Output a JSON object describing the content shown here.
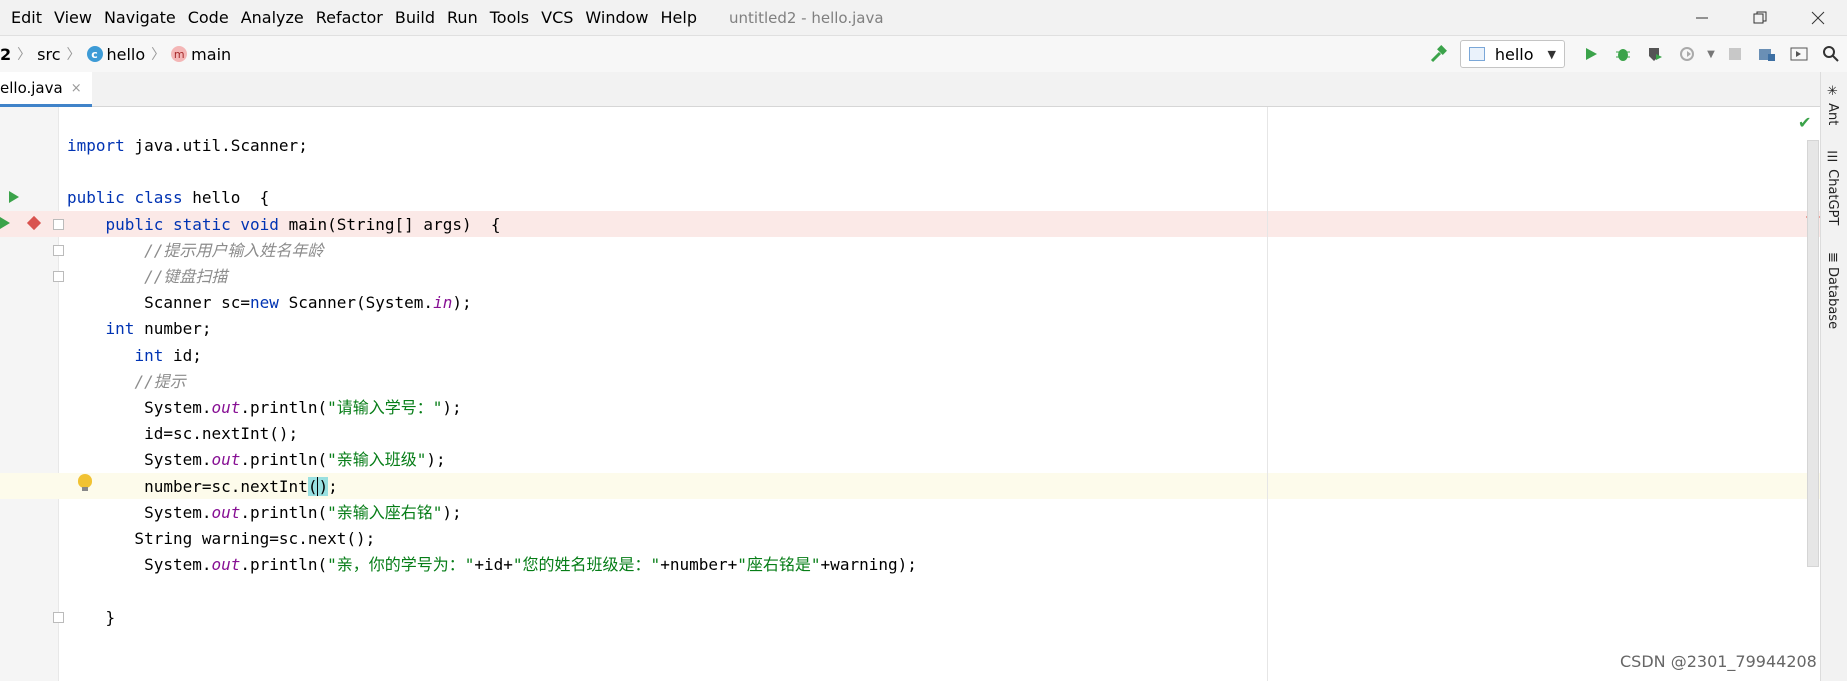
{
  "menubar": {
    "items": [
      "Edit",
      "View",
      "Navigate",
      "Code",
      "Analyze",
      "Refactor",
      "Build",
      "Run",
      "Tools",
      "VCS",
      "Window",
      "Help"
    ],
    "title": "untitled2 - hello.java"
  },
  "navbar": {
    "crumbs": [
      "2",
      "src",
      "hello",
      "main"
    ],
    "class_icon_letter": "c",
    "method_icon_letter": "m",
    "run_config": "hello"
  },
  "tabbar": {
    "active_tab": "hello.java",
    "active_tab_visible": "ello.java",
    "close_glyph": "×"
  },
  "editor": {
    "lines": [
      {
        "id": "l1",
        "text": "import java.util.Scanner;"
      },
      {
        "id": "l2",
        "text": ""
      },
      {
        "id": "l3",
        "text": "public class hello  {"
      },
      {
        "id": "l4",
        "text": "    public static void main(String[] args)  {"
      },
      {
        "id": "l5",
        "text": "        //提示用户输入姓名年龄"
      },
      {
        "id": "l6",
        "text": "        //键盘扫描"
      },
      {
        "id": "l7",
        "text": "        Scanner sc=new Scanner(System.in);"
      },
      {
        "id": "l8",
        "text": "    int number;"
      },
      {
        "id": "l9",
        "text": "       int id;"
      },
      {
        "id": "l10",
        "text": "       //提示"
      },
      {
        "id": "l11",
        "text": "        System.out.println(\"请输入学号：\");"
      },
      {
        "id": "l12",
        "text": "        id=sc.nextInt();"
      },
      {
        "id": "l13",
        "text": "        System.out.println(\"亲输入班级\");"
      },
      {
        "id": "l14",
        "text": "        number=sc.nextInt();"
      },
      {
        "id": "l15",
        "text": "        System.out.println(\"亲输入座右铭\");"
      },
      {
        "id": "l16",
        "text": "       String warning=sc.next();"
      },
      {
        "id": "l17",
        "text": "        System.out.println(\"亲，你的学号为：\"+id+\"您的姓名班级是：\"+number+\"座右铭是\"+warning);"
      },
      {
        "id": "l18",
        "text": ""
      },
      {
        "id": "l19",
        "text": "    }"
      }
    ]
  },
  "tool_strip": [
    "Ant",
    "ChatGPT",
    "Database"
  ],
  "watermark": "CSDN @2301_79944208",
  "colors": {
    "keyword": "#0033b3",
    "comment": "#8c8c8c",
    "string": "#067d17",
    "static_field": "#871094",
    "run_green": "#3ba34a",
    "breakpoint": "#d9534f"
  }
}
